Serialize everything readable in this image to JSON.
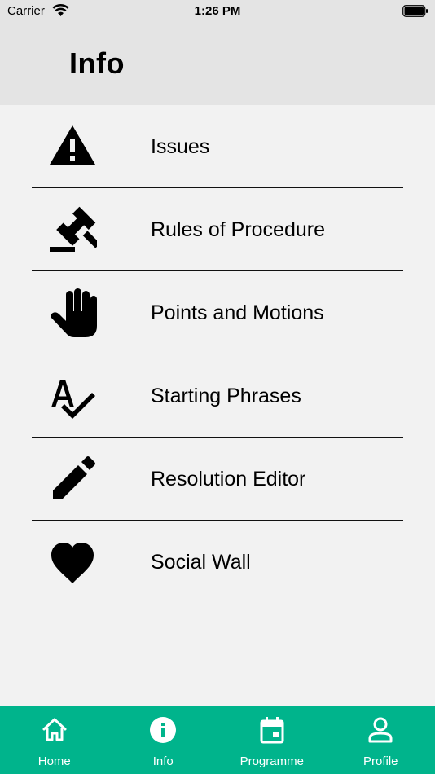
{
  "status_bar": {
    "carrier": "Carrier",
    "time": "1:26 PM",
    "wifi_icon": "wifi-icon",
    "battery_icon": "battery-icon"
  },
  "header": {
    "title": "Info"
  },
  "menu": {
    "items": [
      {
        "label": "Issues",
        "icon": "warning-icon"
      },
      {
        "label": "Rules of Procedure",
        "icon": "gavel-icon"
      },
      {
        "label": "Points and Motions",
        "icon": "hand-icon"
      },
      {
        "label": "Starting Phrases",
        "icon": "spellcheck-icon"
      },
      {
        "label": "Resolution Editor",
        "icon": "pencil-icon"
      },
      {
        "label": "Social Wall",
        "icon": "heart-icon"
      }
    ]
  },
  "tab_bar": {
    "accent_color": "#00b48c",
    "tabs": [
      {
        "label": "Home",
        "icon": "home-icon"
      },
      {
        "label": "Info",
        "icon": "info-icon",
        "selected": true
      },
      {
        "label": "Programme",
        "icon": "calendar-icon"
      },
      {
        "label": "Profile",
        "icon": "person-icon"
      }
    ]
  }
}
